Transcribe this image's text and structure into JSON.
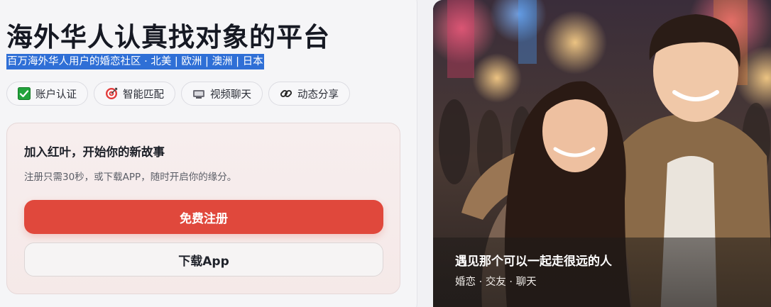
{
  "hero": {
    "title": "海外华人认真找对象的平台",
    "subtitle": "百万海外华人用户的婚恋社区 · 北美 | 欧洲 | 澳洲 | 日本"
  },
  "features": [
    {
      "label": "账户认证",
      "icon": "check-box-icon"
    },
    {
      "label": "智能匹配",
      "icon": "target-icon"
    },
    {
      "label": "视频聊天",
      "icon": "video-camera-icon"
    },
    {
      "label": "动态分享",
      "icon": "link-icon"
    }
  ],
  "join": {
    "title": "加入红叶，开始你的新故事",
    "description": "注册只需30秒，或下载APP，随时开启你的缘分。",
    "register_label": "免费注册",
    "download_label": "下载App"
  },
  "photo": {
    "caption_title": "遇见那个可以一起走很远的人",
    "caption_sub": "婚恋 · 交友 · 聊天"
  },
  "colors": {
    "primary": "#e0483c",
    "highlight": "#2f6fd6",
    "check_green": "#22a33c"
  }
}
